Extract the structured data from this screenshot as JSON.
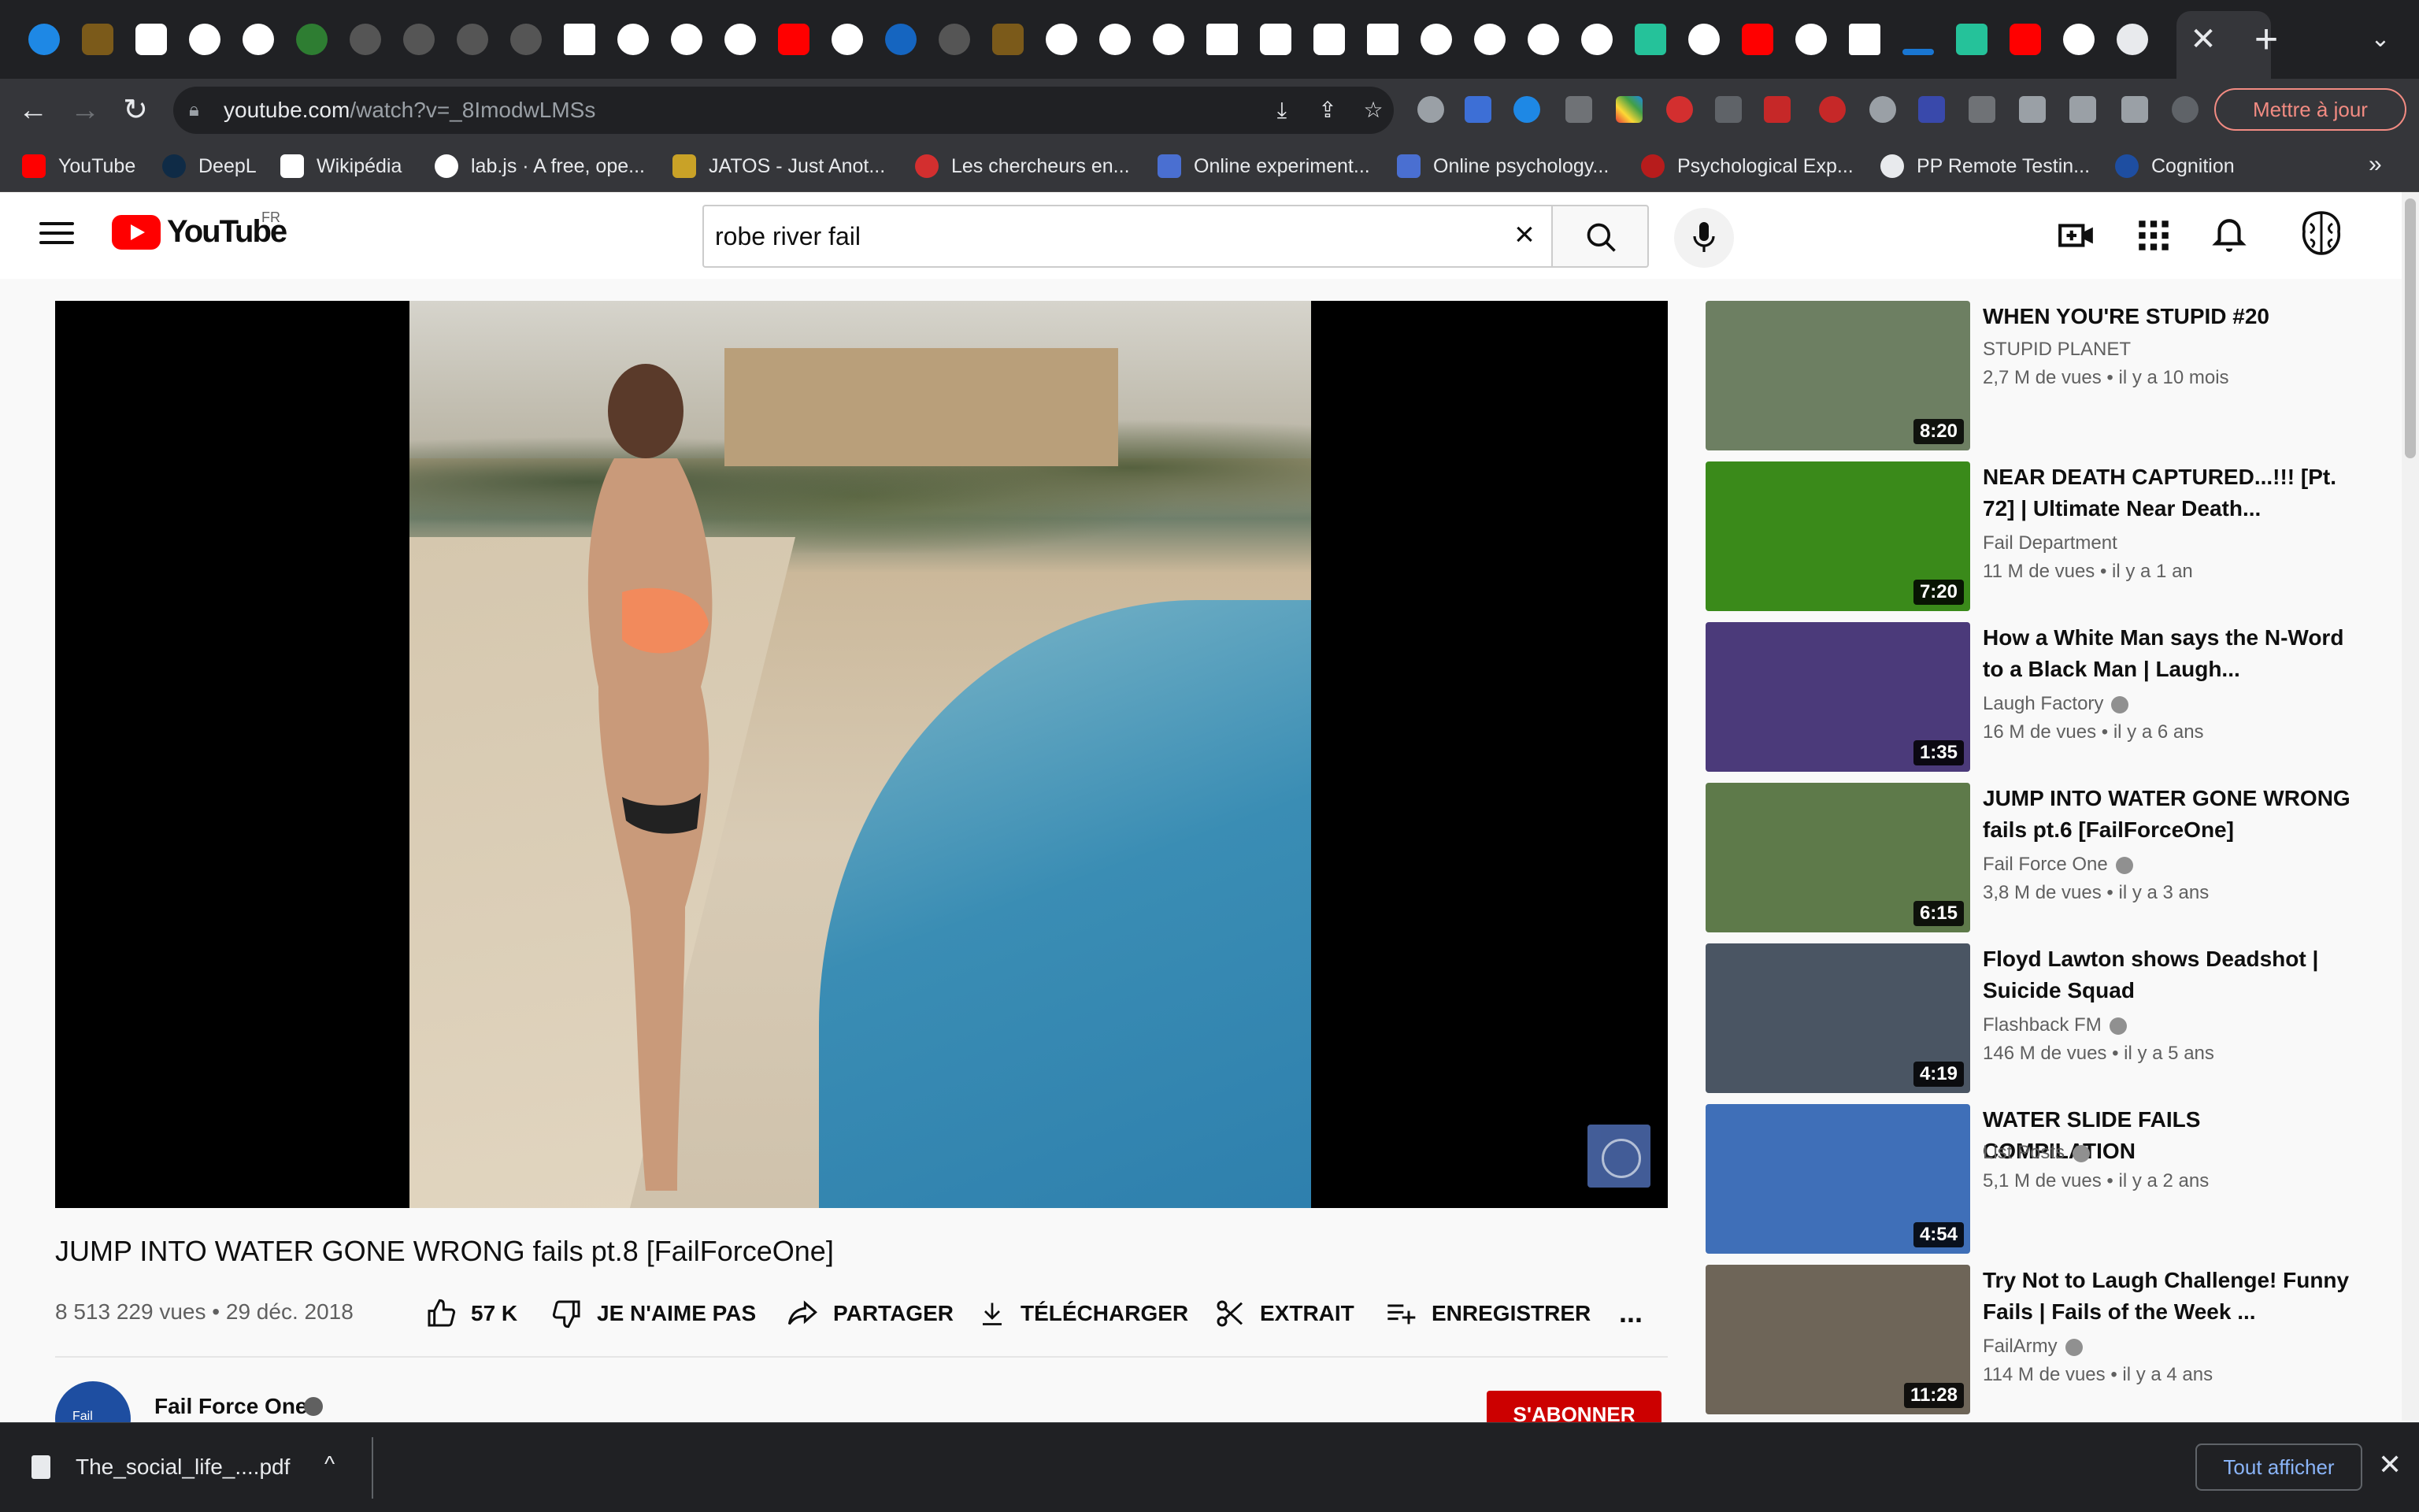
{
  "browser": {
    "tab_close_glyph": "✕",
    "new_tab_glyph": "+",
    "tab_menu_glyph": "⌄",
    "url_host": "youtube.com",
    "url_path": "/watch?v=_8ImodwLMSs",
    "update_button": "Mettre à jour",
    "bookmarks": [
      "YouTube",
      "DeepL",
      "Wikipédia",
      "lab.js · A free, ope...",
      "JATOS - Just Anot...",
      "Les chercheurs en...",
      "Online experiment...",
      "Online psychology...",
      "Psychological Exp...",
      "PP Remote Testin...",
      "Cognition"
    ],
    "bookmarks_more": "»"
  },
  "youtube": {
    "logo_text": "YouTube",
    "region": "FR",
    "search_query": "robe river fail",
    "video": {
      "title": "JUMP INTO WATER GONE WRONG fails pt.8 [FailForceOne]",
      "views": "8 513 229 vues",
      "date": "29 déc. 2018",
      "likes": "57 K",
      "dislike_label": "JE N'AIME PAS",
      "share_label": "PARTAGER",
      "download_label": "TÉLÉCHARGER",
      "clip_label": "EXTRAIT",
      "save_label": "ENREGISTRER",
      "more_label": "...",
      "channel": "Fail Force One",
      "channel_avatar_text": "Fail",
      "subscribe_label": "S'ABONNER"
    },
    "recommendations": [
      {
        "title": "WHEN YOU'RE STUPID #20",
        "channel": "STUPID PLANET",
        "verified": false,
        "meta": "2,7 M de vues • il y a 10 mois",
        "duration": "8:20",
        "thumb_color": "#6d7f62"
      },
      {
        "title": "NEAR DEATH CAPTURED...!!! [Pt. 72] | Ultimate Near Death...",
        "channel": "Fail Department",
        "verified": false,
        "meta": "11 M de vues • il y a 1 an",
        "duration": "7:20",
        "thumb_color": "#3a8a1a"
      },
      {
        "title": "How a White Man says the N-Word to a Black Man | Laugh...",
        "channel": "Laugh Factory",
        "verified": true,
        "meta": "16 M de vues • il y a 6 ans",
        "duration": "1:35",
        "thumb_color": "#4b3a7a"
      },
      {
        "title": "JUMP INTO WATER GONE WRONG fails pt.6 [FailForceOne]",
        "channel": "Fail Force One",
        "verified": true,
        "meta": "3,8 M de vues • il y a 3 ans",
        "duration": "6:15",
        "thumb_color": "#5e7a4a"
      },
      {
        "title": "Floyd Lawton shows Deadshot | Suicide Squad",
        "channel": "Flashback FM",
        "verified": true,
        "meta": "146 M de vues • il y a 5 ans",
        "duration": "4:19",
        "thumb_color": "#4a5563"
      },
      {
        "title": "WATER SLIDE FAILS COMPILATION",
        "channel": "List Posts",
        "verified": true,
        "meta": "5,1 M de vues • il y a 2 ans",
        "duration": "4:54",
        "thumb_color": "#3f6fb8"
      },
      {
        "title": "Try Not to Laugh Challenge! Funny Fails | Fails of the Week ...",
        "channel": "FailArmy",
        "verified": true,
        "meta": "114 M de vues • il y a 4 ans",
        "duration": "11:28",
        "thumb_color": "#6e6558"
      }
    ]
  },
  "downloads": {
    "file_name": "The_social_life_....pdf",
    "chevron": "^",
    "show_all": "Tout afficher",
    "close_glyph": "✕"
  },
  "colors": {
    "accent": "#ff0000",
    "subscribe": "#cc0000",
    "link": "#8ab4f8"
  }
}
